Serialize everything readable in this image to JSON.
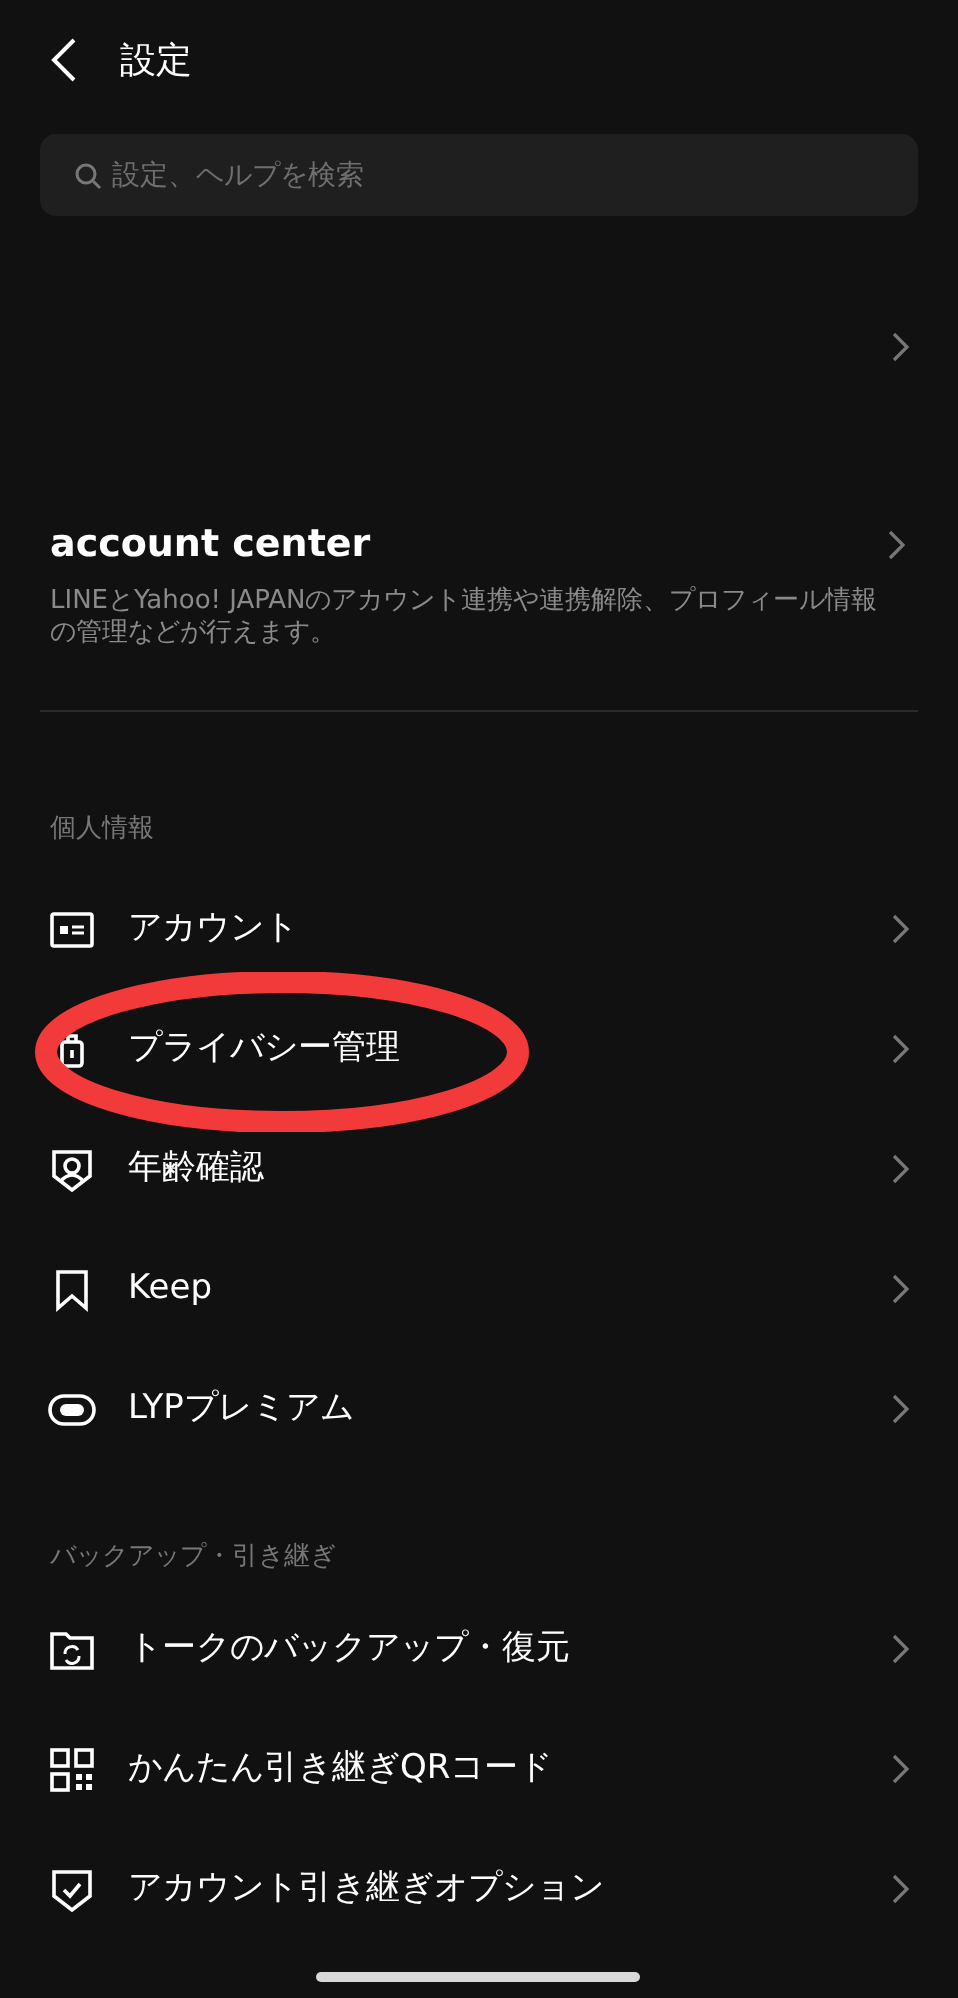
{
  "header": {
    "title": "設定"
  },
  "search": {
    "placeholder": "設定、ヘルプを検索"
  },
  "account_center": {
    "title": "account center",
    "description": "LINEとYahoo! JAPANのアカウント連携や連携解除、プロフィール情報の管理などが行えます。"
  },
  "sections": [
    {
      "title": "個人情報",
      "items": [
        {
          "label": "アカウント",
          "highlighted": false
        },
        {
          "label": "プライバシー管理",
          "highlighted": true
        },
        {
          "label": "年齢確認",
          "highlighted": false
        },
        {
          "label": "Keep",
          "highlighted": false
        },
        {
          "label": "LYPプレミアム",
          "highlighted": false
        }
      ]
    },
    {
      "title": "バックアップ・引き継ぎ",
      "items": [
        {
          "label": "トークのバックアップ・復元",
          "highlighted": false
        },
        {
          "label": "かんたん引き継ぎQRコード",
          "highlighted": false
        },
        {
          "label": "アカウント引き継ぎオプション",
          "highlighted": false
        }
      ]
    }
  ]
}
